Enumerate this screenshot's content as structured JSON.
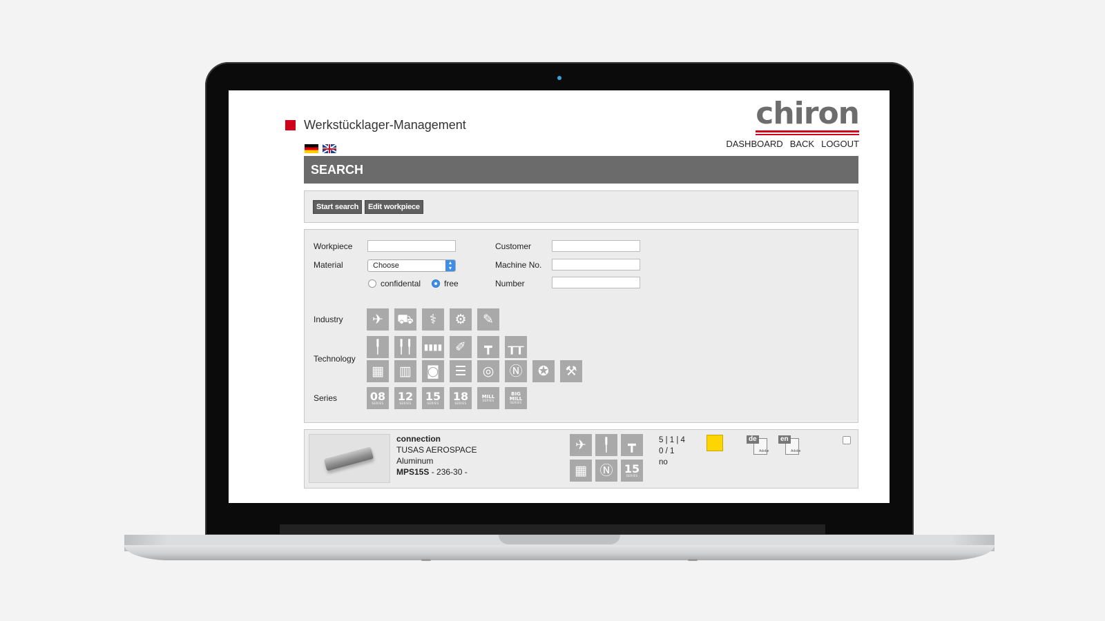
{
  "app": {
    "title": "Werkstücklager-Management",
    "logo_text": "chiron"
  },
  "nav": {
    "dashboard": "DASHBOARD",
    "back": "BACK",
    "logout": "LOGOUT"
  },
  "section": {
    "title": "SEARCH"
  },
  "actions": {
    "start_search": "Start search",
    "edit_workpiece": "Edit workpiece"
  },
  "filters": {
    "workpiece_label": "Workpiece",
    "material_label": "Material",
    "material_selected": "Choose",
    "customer_label": "Customer",
    "machine_label": "Machine No.",
    "number_label": "Number",
    "confidential_label": "confidental",
    "free_label": "free",
    "industry_label": "Industry",
    "technology_label": "Technology",
    "series_label": "Series",
    "series": [
      {
        "num": "08",
        "sub": "SERIES"
      },
      {
        "num": "12",
        "sub": "SERIES"
      },
      {
        "num": "15",
        "sub": "SERIES"
      },
      {
        "num": "18",
        "sub": "SERIES"
      },
      {
        "num": "MILL",
        "sub": "SERIES"
      },
      {
        "num": "BIG MILL",
        "sub": "SERIES"
      }
    ]
  },
  "icons": {
    "industry": [
      "aerospace-icon",
      "automotive-icon",
      "medical-icon",
      "general-engineering-icon",
      "tool-icon"
    ],
    "technology_row1": [
      "single-spindle-icon",
      "double-spindle-icon",
      "multi-spindle-icon",
      "milling-turning-icon",
      "tool-changer-icon",
      "linear-loader-icon"
    ],
    "technology_row2": [
      "pallet-icon",
      "workpiece-carrier-icon",
      "rotary-table-icon",
      "line-loading-icon",
      "automation-icon",
      "nc-swivel-icon",
      "star-turret-icon",
      "robot-arm-icon"
    ]
  },
  "result": {
    "name": "connection",
    "customer": "TUSAS AEROSPACE",
    "material": "Aluminum",
    "machine": "MPS15S",
    "machine_suffix": " - 236-30 -",
    "stat1": "5 | 1 | 4",
    "stat2": "0 / 1",
    "stat3": "no",
    "status_color": "#ffd500",
    "series_num": "15",
    "series_sub": "SERIES",
    "pdf_de": "de",
    "pdf_en": "en",
    "pdf_brand": "Adobe"
  }
}
